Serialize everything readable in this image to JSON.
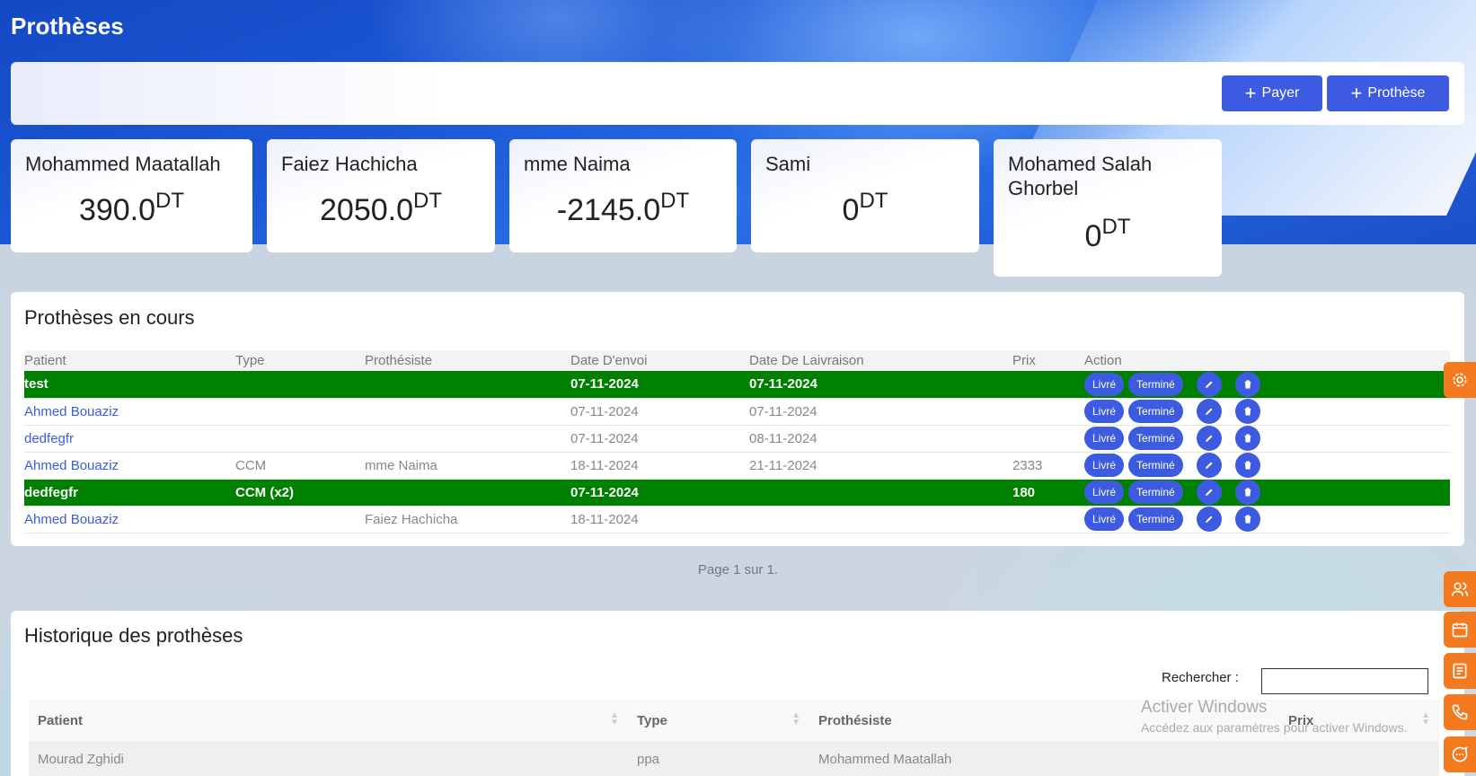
{
  "page": {
    "title": "Prothèses"
  },
  "toolbar": {
    "pay_button": "Payer",
    "prosthesis_button": "Prothèse"
  },
  "balances": [
    {
      "name": "Mohammed Maatallah",
      "amount": "390.0",
      "currency": "DT"
    },
    {
      "name": "Faiez Hachicha",
      "amount": "2050.0",
      "currency": "DT"
    },
    {
      "name": "mme Naima",
      "amount": "-2145.0",
      "currency": "DT"
    },
    {
      "name": "Sami",
      "amount": "0",
      "currency": "DT"
    },
    {
      "name": "Mohamed Salah Ghorbel",
      "amount": "0",
      "currency": "DT"
    }
  ],
  "ongoing": {
    "title": "Prothèses en cours",
    "columns": [
      "Patient",
      "Type",
      "Prothésiste",
      "Date D'envoi",
      "Date De Laivraison",
      "Prix",
      "Action"
    ],
    "rows": [
      {
        "patient": "test",
        "type": "",
        "technician": "",
        "sent": "07-11-2024",
        "delivery": "07-11-2024",
        "price": "",
        "highlight": true
      },
      {
        "patient": "Ahmed Bouaziz",
        "type": "",
        "technician": "",
        "sent": "07-11-2024",
        "delivery": "07-11-2024",
        "price": "",
        "highlight": false
      },
      {
        "patient": "dedfegfr",
        "type": "",
        "technician": "",
        "sent": "07-11-2024",
        "delivery": "08-11-2024",
        "price": "",
        "highlight": false
      },
      {
        "patient": "Ahmed Bouaziz",
        "type": "CCM",
        "technician": "mme Naima",
        "sent": "18-11-2024",
        "delivery": "21-11-2024",
        "price": "2333",
        "highlight": false
      },
      {
        "patient": "dedfegfr",
        "type": "CCM (x2)",
        "technician": "",
        "sent": "07-11-2024",
        "delivery": "",
        "price": "180",
        "highlight": true
      },
      {
        "patient": "Ahmed Bouaziz",
        "type": "",
        "technician": "Faiez Hachicha",
        "sent": "18-11-2024",
        "delivery": "",
        "price": "",
        "highlight": false
      }
    ],
    "action_delivered": "Livré",
    "action_done": "Terminé",
    "pagination": "Page 1 sur 1."
  },
  "history": {
    "title": "Historique des prothèses",
    "search_label": "Rechercher :",
    "columns": [
      "Patient",
      "Type",
      "Prothésiste",
      "Prix"
    ],
    "rows": [
      {
        "patient": "Mourad Zghidi",
        "type": "ppa",
        "technician": "Mohammed Maatallah",
        "price": ""
      }
    ]
  },
  "watermark": {
    "line1": "Activer Windows",
    "line2": "Accédez aux paramètres pour activer Windows."
  },
  "side_icons": [
    "settings-icon",
    "users-icon",
    "calendar-icon",
    "notes-icon",
    "phone-icon",
    "chat-icon"
  ],
  "colors": {
    "primary": "#3d5be0",
    "highlight_row": "#008000",
    "side_button": "#f47a20"
  }
}
